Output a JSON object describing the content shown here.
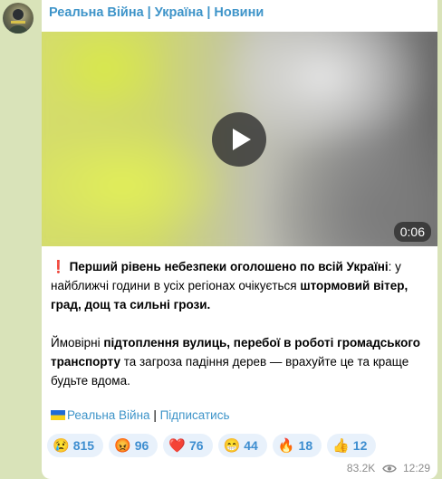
{
  "channel": {
    "name": "Реальна Війна | Україна | Новини"
  },
  "video": {
    "duration": "0:06"
  },
  "message": {
    "p1": {
      "excl": "❗",
      "b1": "Перший рівень небезпеки оголошено по всій Україні",
      "t1": ": у найближчі години в усіх регіонах очікується ",
      "b2": "штормовий вітер, град, дощ та сильні грози."
    },
    "p2": {
      "t1": "Ймовірні ",
      "b1": "підтоплення вулиць, перебої в роботі громадського транспорту",
      "t2": " та загроза падіння дерев — врахуйте це та краще будьте вдома."
    }
  },
  "footer": {
    "link_channel": "Реальна Війна",
    "separator": " | ",
    "link_subscribe": "Підписатись"
  },
  "reactions": [
    {
      "emoji": "😢",
      "count": "815"
    },
    {
      "emoji": "😡",
      "count": "96"
    },
    {
      "emoji": "❤️",
      "count": "76"
    },
    {
      "emoji": "😁",
      "count": "44"
    },
    {
      "emoji": "🔥",
      "count": "18"
    },
    {
      "emoji": "👍",
      "count": "12"
    }
  ],
  "meta": {
    "views": "83.2K",
    "time": "12:29"
  },
  "colors": {
    "accent": "#3e94c9",
    "chat_background": "#d9e3b9",
    "reaction_bg": "#e8f1fb"
  }
}
